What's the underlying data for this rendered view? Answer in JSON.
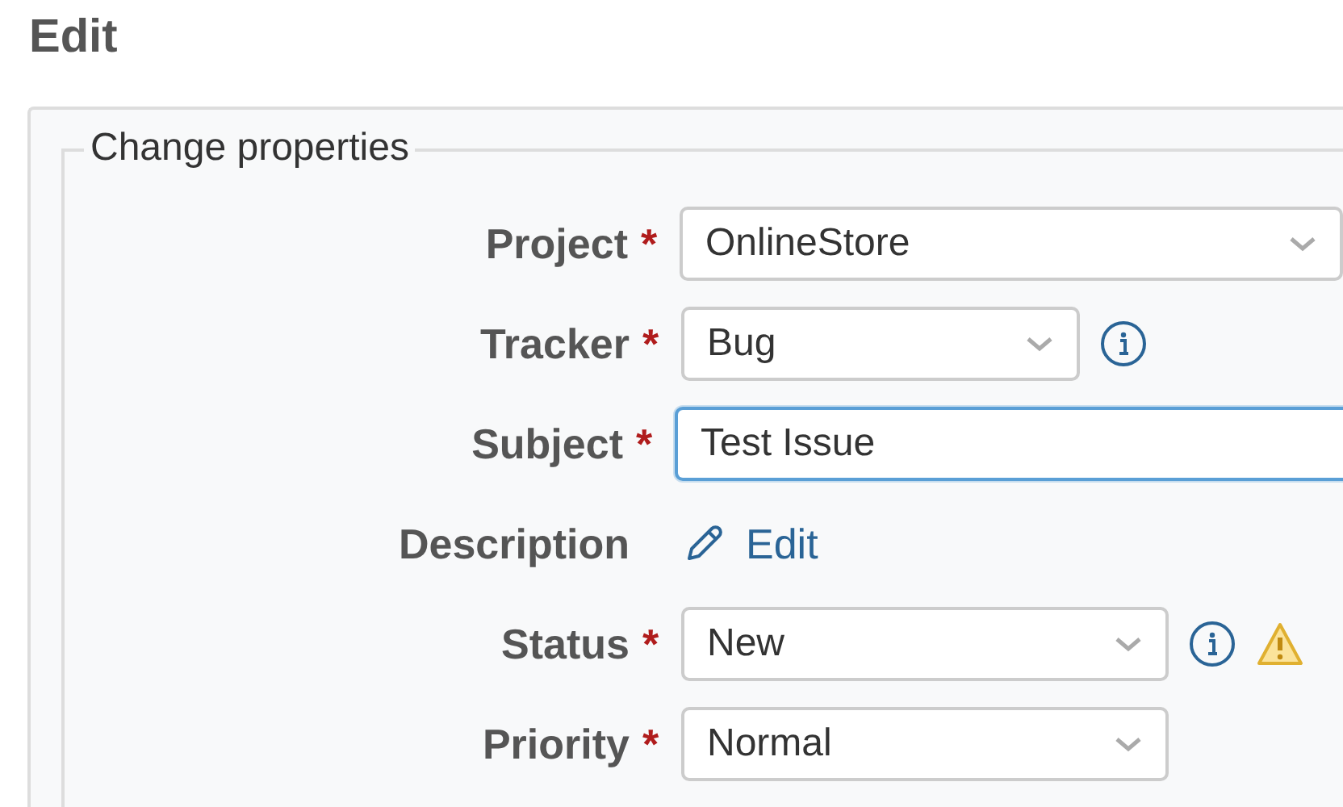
{
  "heading": "Edit",
  "fieldset": {
    "legend": "Change properties",
    "fields": [
      {
        "kind": "select",
        "label": "Project",
        "required_mark": "*",
        "value": "OnlineStore",
        "focused": false,
        "info": false,
        "warning": false
      },
      {
        "kind": "select",
        "label": "Tracker",
        "required_mark": "*",
        "value": "Bug",
        "focused": false,
        "info": true,
        "warning": false
      },
      {
        "kind": "text",
        "label": "Subject",
        "required_mark": "*",
        "value": "Test Issue",
        "focused": true,
        "info": false,
        "warning": false
      },
      {
        "kind": "link",
        "label": "Description",
        "value": "Edit",
        "info": false,
        "warning": false
      },
      {
        "kind": "select",
        "label": "Status",
        "required_mark": "*",
        "value": "New",
        "focused": false,
        "info": true,
        "warning": true
      },
      {
        "kind": "select",
        "label": "Priority",
        "required_mark": "*",
        "value": "Normal",
        "focused": false,
        "info": false,
        "warning": false
      }
    ]
  }
}
